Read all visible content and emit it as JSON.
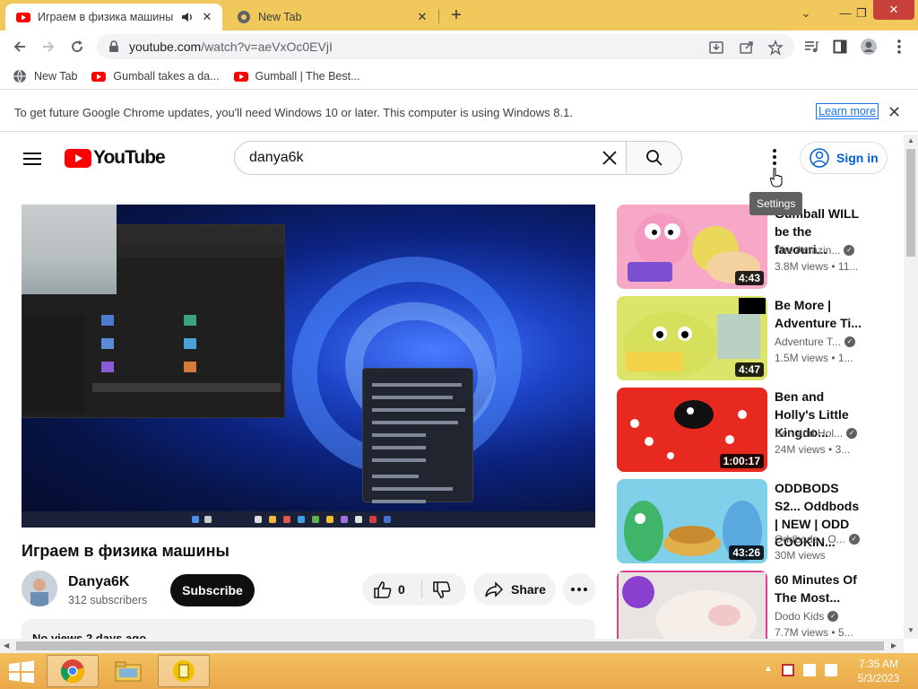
{
  "browser": {
    "tabs": [
      {
        "title": "Играем в физика машины",
        "active": true,
        "audio": true
      },
      {
        "title": "New Tab",
        "active": false
      }
    ],
    "url_host": "youtube.com",
    "url_path": "/watch?v=aeVxOc0EVjI",
    "bookmarks": [
      {
        "label": "New Tab",
        "icon": "globe-icon"
      },
      {
        "label": "Gumball takes a da...",
        "icon": "youtube-icon"
      },
      {
        "label": "Gumball | The Best...",
        "icon": "youtube-icon"
      }
    ],
    "infobar": {
      "message": "To get future Google Chrome updates, you'll need Windows 10 or later. This computer is using Windows 8.1.",
      "learn_more": "Learn more"
    }
  },
  "youtube": {
    "logo_text": "YouTube",
    "search_value": "danya6k",
    "sign_in": "Sign in",
    "tooltip": "Settings",
    "video": {
      "title": "Играем в физика машины",
      "channel": "Danya6K",
      "subscribers": "312 subscribers",
      "subscribe_label": "Subscribe",
      "likes": "0",
      "share_label": "Share",
      "description_preview": "No views  2 days ago"
    },
    "recommended": [
      {
        "title": "Gumball WILL be the favouri...",
        "channel": "The Amazin...",
        "views": "3.8M views",
        "age": "11...",
        "duration": "4:43"
      },
      {
        "title": "Be More | Adventure Ti...",
        "channel": "Adventure T...",
        "views": "1.5M views",
        "age": "1...",
        "duration": "4:47"
      },
      {
        "title": "Ben and Holly's Little Kingdo...",
        "channel": "Ben and Hol...",
        "views": "24M views",
        "age": "3...",
        "duration": "1:00:17"
      },
      {
        "title": "ODDBODS  S2... Oddbods | NEW | ODD COOKIN...",
        "channel": "Oddbods - O...",
        "views": "30M views",
        "age": "",
        "duration": "43:26"
      },
      {
        "title": "60 Minutes Of The Most...",
        "channel": "Dodo Kids",
        "views": "7.7M views",
        "age": "5...",
        "duration": ""
      }
    ]
  },
  "taskbar": {
    "time": "7:35 AM",
    "date": "5/3/2023"
  },
  "colors": {
    "chrome_frame": "#f0c85c",
    "youtube_red": "#ff0000",
    "signin_blue": "#065fd4"
  }
}
